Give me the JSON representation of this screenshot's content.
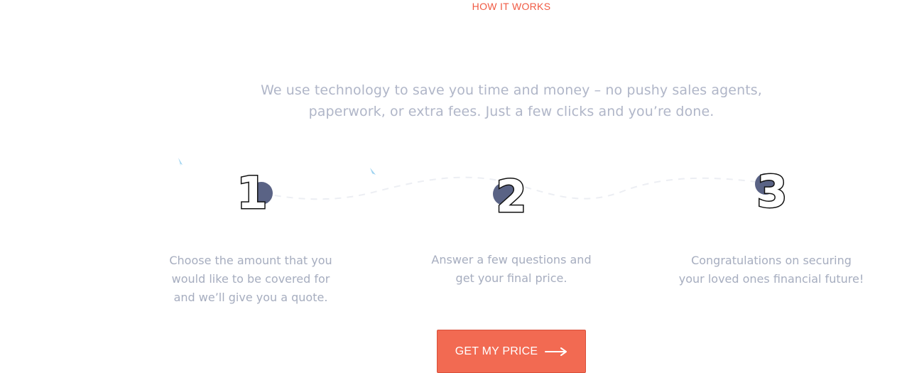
{
  "section": {
    "eyebrow": "HOW IT WORKS",
    "intro_line1": "We use technology to save you time and money – no pushy sales agents,",
    "intro_line2": "paperwork, or extra fees. Just a few clicks and you’re done."
  },
  "steps": [
    {
      "number": "1",
      "desc_line1": "Choose the amount that you",
      "desc_line2": "would like to be covered for",
      "desc_line3": "and we’ll give you a quote."
    },
    {
      "number": "2",
      "desc_line1": "Answer a few questions and",
      "desc_line2": "get your final price."
    },
    {
      "number": "3",
      "desc_line1": "Congratulations on securing",
      "desc_line2": "your loved ones financial future!"
    }
  ],
  "cta": {
    "label": "GET MY PRICE",
    "icon": "arrow-right-icon"
  },
  "colors": {
    "accent": "#f05a43",
    "button": "#f26a52",
    "dot": "#5a6385",
    "muted_text": "#b0b6c8",
    "sparkle": "#9fd3f0"
  }
}
